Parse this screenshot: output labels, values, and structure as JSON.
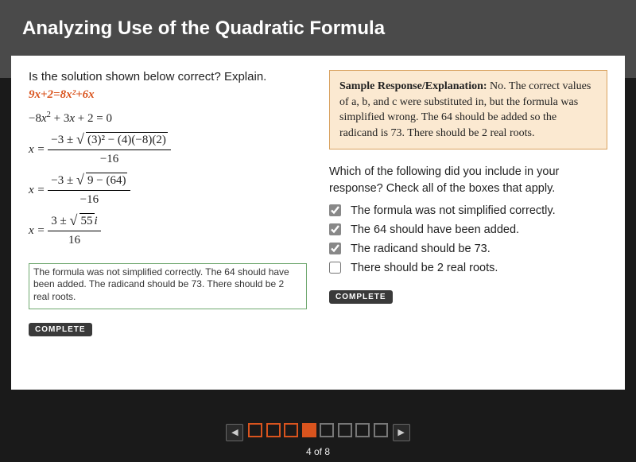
{
  "header": {
    "title": "Analyzing Use of the Quadratic Formula"
  },
  "left": {
    "prompt": "Is the solution shown below correct? Explain.",
    "equation_orange": "9x+2=8x²+6x",
    "math": {
      "line1_a": "−8",
      "line1_b": " + 3",
      "line1_c": " + 2 = 0",
      "eq": "x =",
      "frac2_num_a": "−3 ± ",
      "frac2_num_rad": "(3)² − (4)(−8)(2)",
      "frac2_den": "−16",
      "frac3_num_a": "−3 ± ",
      "frac3_num_rad": "9 − (64)",
      "frac3_den": "−16",
      "frac4_num_a": "3 ± ",
      "frac4_num_rad": "55",
      "frac4_num_i": "i",
      "frac4_den": "16"
    },
    "answer_text": "The formula was not simplified correctly. The 64 should have been added. The radicand should be 73. There should be 2 real roots.",
    "complete_label": "COMPLETE"
  },
  "right": {
    "sample_strong": "Sample Response/Explanation:",
    "sample_body": " No. The correct values of a, b, and c were substituted in, but the formula was simplified wrong. The 64 should be added so the radicand is 73. There should be 2 real roots.",
    "check_prompt": "Which of the following did you include in your response? Check all of the boxes that apply.",
    "options": [
      {
        "label": "The formula was not simplified correctly.",
        "checked": true
      },
      {
        "label": "The 64 should have been added.",
        "checked": true
      },
      {
        "label": "The radicand should be 73.",
        "checked": true
      },
      {
        "label": "There should be 2 real roots.",
        "checked": false
      }
    ],
    "complete_label": "COMPLETE"
  },
  "footer": {
    "prev_glyph": "◀",
    "next_glyph": "▶",
    "page_label": "4 of 8",
    "total_pages": 8,
    "current_page": 4,
    "done_pages": [
      1,
      2,
      3
    ]
  }
}
